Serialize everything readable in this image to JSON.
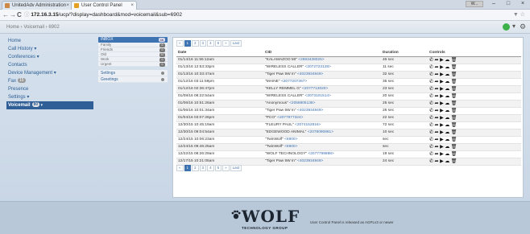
{
  "browser": {
    "tabs": [
      {
        "label": "UnitedAdv Administration",
        "active": false
      },
      {
        "label": "User Control Panel",
        "active": true
      }
    ],
    "nav": {
      "back": "←",
      "forward": "→",
      "reload": "C"
    },
    "url_host": "172.16.3.15",
    "url_path": "/ucp/?display=dashboard&mod=voicemail&sub=6902",
    "window_user": "W..."
  },
  "header": {
    "breadcrumb": "Home › Voicemail › 6902"
  },
  "sidebar": {
    "items": [
      {
        "label": "Home",
        "badge": null,
        "active": false
      },
      {
        "label": "Call History ▾",
        "badge": null,
        "active": false
      },
      {
        "label": "Conferences ▾",
        "badge": null,
        "active": false
      },
      {
        "label": "Contacts",
        "badge": null,
        "active": false
      },
      {
        "label": "Device Management ▾",
        "badge": null,
        "active": false
      },
      {
        "label": "Fax",
        "badge": "15",
        "active": false
      },
      {
        "label": "Presence",
        "badge": null,
        "active": false
      },
      {
        "label": "Settings ▾",
        "badge": null,
        "active": false
      },
      {
        "label": "Voicemail",
        "badge": "80",
        "active": true
      }
    ]
  },
  "mailbox": {
    "header_label": "INBOX",
    "header_count": "46",
    "folders": [
      {
        "label": "Family",
        "count": "0"
      },
      {
        "label": "Friends",
        "count": "0"
      },
      {
        "label": "Old",
        "count": "37"
      },
      {
        "label": "Work",
        "count": "0"
      },
      {
        "label": "Urgent",
        "count": "0"
      }
    ],
    "links": [
      {
        "label": "Settings"
      },
      {
        "label": "Greetings"
      }
    ]
  },
  "pagination": {
    "prev": "«",
    "pages": [
      "1",
      "2",
      "3",
      "4",
      "5"
    ],
    "current": "1",
    "next": "»",
    "last": "Last"
  },
  "table": {
    "columns": [
      "Date",
      "CID",
      "Duration",
      "Controls"
    ],
    "rows": [
      {
        "date": "01/14/16 11:55:12am",
        "cid_name": "\"KALAMAZOO MI\"",
        "cid_num": "<2693438025>",
        "duration": "46 sec"
      },
      {
        "date": "01/13/16 12:53:33pm",
        "cid_name": "\"WIRELESS CALLER\"",
        "cid_num": "<2072723128>",
        "duration": "11 sec"
      },
      {
        "date": "01/13/16 10:33:47am",
        "cid_name": "\"Tiger Paw 5W In\"",
        "cid_num": "<4023934949>",
        "duration": "32 sec"
      },
      {
        "date": "01/12/16 03:11:59pm",
        "cid_name": "\"MAINE\"",
        "cid_num": "<2077207367>",
        "duration": "35 sec"
      },
      {
        "date": "01/12/16 02:36:47pm",
        "cid_name": "\"KELLY REMMEL G\"",
        "cid_num": "<2077713020>",
        "duration": "23 sec"
      },
      {
        "date": "01/08/16 08:22:54am",
        "cid_name": "\"WIRELESS CALLER\"",
        "cid_num": "<2073101514>",
        "duration": "20 sec"
      },
      {
        "date": "01/06/16 10:51:26am",
        "cid_name": "\"Anonymous\"",
        "cid_num": "<2058805138>",
        "duration": "25 sec"
      },
      {
        "date": "01/06/16 10:01:34am",
        "cid_name": "\"Tiger Paw 5W In\"",
        "cid_num": "<4023934949>",
        "duration": "26 sec"
      },
      {
        "date": "01/04/16 03:07:26pm",
        "cid_name": "\"PCO\"",
        "cid_num": "<2077977324>",
        "duration": "22 sec"
      },
      {
        "date": "12/30/15 10:45:19am",
        "cid_name": "\"FLEURY PAUL\"",
        "cid_num": "<2074152816>",
        "duration": "72 sec"
      },
      {
        "date": "12/30/15 09:04:54am",
        "cid_name": "\"EDGEWOOD ANIMAL\"",
        "cid_num": "<2078090861>",
        "duration": "10 sec"
      },
      {
        "date": "12/24/15 10:06:23am",
        "cid_name": "\"TwinWolf\"",
        "cid_num": "<6900>",
        "duration": "sec"
      },
      {
        "date": "12/24/15 09:46:25am",
        "cid_name": "\"TwinWolf\"",
        "cid_num": "<6900>",
        "duration": "sec"
      },
      {
        "date": "12/22/15 08:26:29am",
        "cid_name": "\"WOLF TECHNOLOGY\"",
        "cid_num": "<2077769888>",
        "duration": "19 sec"
      },
      {
        "date": "12/17/15 10:21:05am",
        "cid_name": "\"Tiger Paw 5W In\"",
        "cid_num": "<4023934949>",
        "duration": "24 sec"
      }
    ]
  },
  "footer": {
    "brand": "WOLF",
    "brand_sub": "TECHNOLOGY GROUP",
    "note": "User Control Panel is released as AGPLv3 or newer"
  },
  "icons": {
    "call": "phone-icon",
    "forward": "forward-icon",
    "play": "play-icon",
    "download": "download-icon",
    "delete": "trash-icon"
  },
  "colors": {
    "accent": "#3d73b0",
    "online": "#3cb14a",
    "link": "#2d5f95"
  }
}
